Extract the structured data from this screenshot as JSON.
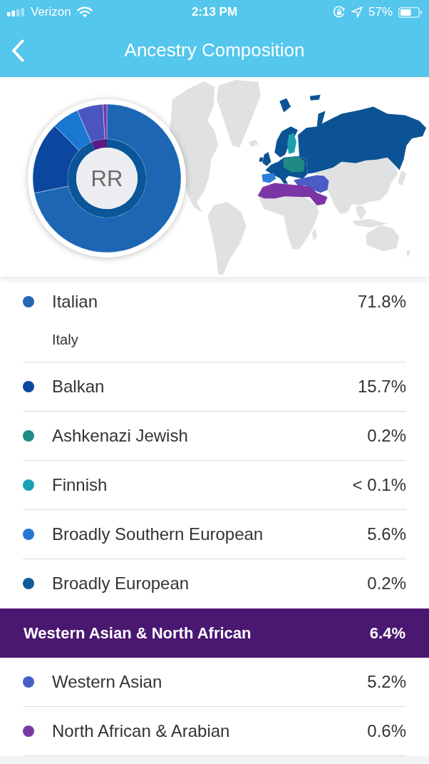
{
  "status_bar": {
    "carrier": "Verizon",
    "time": "2:13 PM",
    "battery": "57%"
  },
  "nav": {
    "title": "Ancestry Composition"
  },
  "chart": {
    "center_label": "RR"
  },
  "groups": [
    {
      "items": [
        {
          "name": "Italian",
          "percent": "71.8%",
          "color": "#2468b4",
          "subtitle": "Italy"
        },
        {
          "name": "Balkan",
          "percent": "15.7%",
          "color": "#0b46a0"
        },
        {
          "name": "Ashkenazi Jewish",
          "percent": "0.2%",
          "color": "#1f8c86"
        },
        {
          "name": "Finnish",
          "percent": "< 0.1%",
          "color": "#1aa0b4"
        },
        {
          "name": "Broadly Southern European",
          "percent": "5.6%",
          "color": "#2479d3"
        },
        {
          "name": "Broadly European",
          "percent": "0.2%",
          "color": "#0e5b99"
        }
      ]
    },
    {
      "name": "Western Asian & North African",
      "percent": "6.4%",
      "items": [
        {
          "name": "Western Asian",
          "percent": "5.2%",
          "color": "#4661c6"
        },
        {
          "name": "North African & Arabian",
          "percent": "0.6%",
          "color": "#7a3aa6"
        }
      ]
    }
  ]
}
